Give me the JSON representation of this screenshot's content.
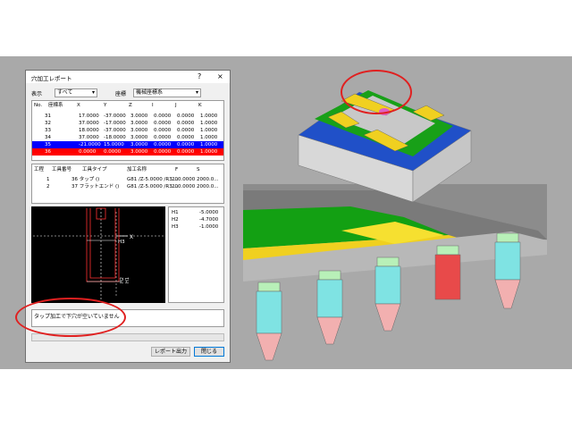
{
  "dialog": {
    "title": "穴加工レポート",
    "help_label": "?",
    "close_label": "×",
    "filter": {
      "label": "表示",
      "value": "すべて"
    },
    "coord": {
      "label": "座標",
      "value": "機械座標系"
    }
  },
  "points_table": {
    "headers": [
      "No.",
      "座標系",
      "X",
      "Y",
      "Z",
      "I",
      "J",
      "K"
    ],
    "rows": [
      {
        "no": "31",
        "x": "17.0000",
        "y": "-37.0000",
        "z": "3.0000",
        "i": "0.0000",
        "j": "0.0000",
        "k": "1.0000",
        "state": "normal"
      },
      {
        "no": "32",
        "x": "37.0000",
        "y": "-17.0000",
        "z": "3.0000",
        "i": "0.0000",
        "j": "0.0000",
        "k": "1.0000",
        "state": "normal"
      },
      {
        "no": "33",
        "x": "18.0000",
        "y": "-37.0000",
        "z": "3.0000",
        "i": "0.0000",
        "j": "0.0000",
        "k": "1.0000",
        "state": "normal"
      },
      {
        "no": "34",
        "x": "37.0000",
        "y": "-18.0000",
        "z": "3.0000",
        "i": "0.0000",
        "j": "0.0000",
        "k": "1.0000",
        "state": "normal"
      },
      {
        "no": "35",
        "x": "-21.0000",
        "y": "15.0000",
        "z": "3.0000",
        "i": "0.0000",
        "j": "0.0000",
        "k": "1.0000",
        "state": "selected-blue"
      },
      {
        "no": "36",
        "x": "0.0000",
        "y": "0.0000",
        "z": "3.0000",
        "i": "0.0000",
        "j": "0.0000",
        "k": "1.0000",
        "state": "selected-red"
      }
    ]
  },
  "process_table": {
    "headers": [
      "工程",
      "工具番号",
      "工具タイプ",
      "加工名称",
      "F",
      "S"
    ],
    "rows": [
      {
        "step": "1",
        "tool": "36 タップ ()",
        "name": "G81 /Z-5.0000 /R3....",
        "f": "200.0000",
        "s": "2000.0..."
      },
      {
        "step": "2",
        "tool": "37 フラットエンド ()",
        "name": "G81 /Z-5.0000 /R3....",
        "f": "200.0000",
        "s": "2000.0..."
      }
    ]
  },
  "preview": {
    "label_x": "X",
    "label_h3": "H3",
    "label_h1": "H1",
    "label_h2": "H2"
  },
  "dimensions": [
    {
      "name": "H1",
      "value": "-5.0000"
    },
    {
      "name": "H2",
      "value": "-4.7000"
    },
    {
      "name": "H3",
      "value": "-1.0000"
    }
  ],
  "message": "タップ加工で下穴が空いていません",
  "buttons": {
    "report": "レポート出力",
    "close": "閉じる"
  },
  "colors": {
    "selected_blue": "#0000ff",
    "selected_red": "#ff0000",
    "highlight_oval": "#e02020",
    "tool_body": "#7fe3e3",
    "tool_tip": "#f2b0b0",
    "error_tool": "#e84a4a"
  }
}
